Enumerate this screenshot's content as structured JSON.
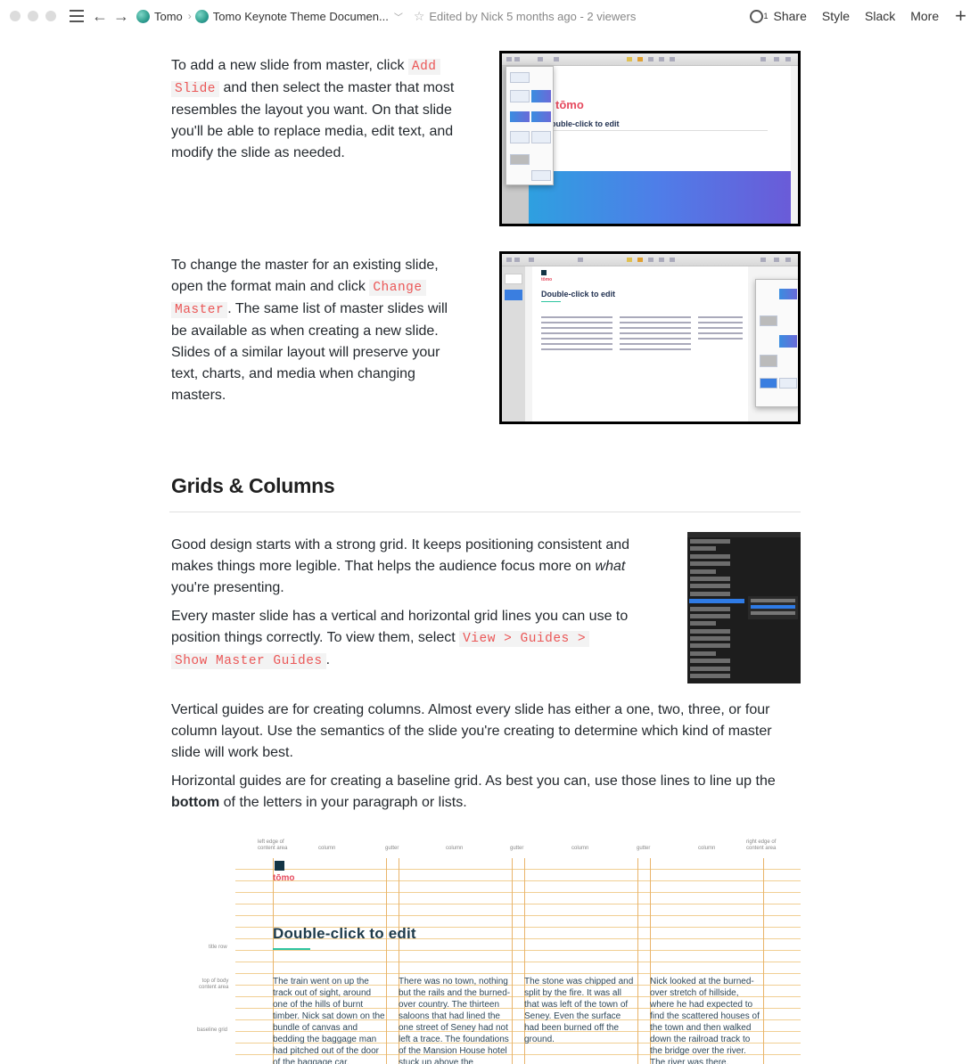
{
  "topbar": {
    "breadcrumb_root": "Tomo",
    "breadcrumb_page": "Tomo Keynote Theme Documen...",
    "edited": "Edited by Nick 5 months ago - 2 viewers",
    "viewers_count": "1",
    "share": "Share",
    "style": "Style",
    "slack": "Slack",
    "more": "More"
  },
  "section_add": {
    "text_before": "To add a new slide from master, click ",
    "code1": "Add",
    "code2": "Slide",
    "text_after": " and then select the master that most resembles the layout you want. On that slide you'll be able to replace media, edit text, and modify the slide as needed.",
    "shot_title": "ouble-click to edit"
  },
  "section_change": {
    "text_before": "To change the master for an existing slide, open the format main and click ",
    "code1": "Change",
    "code2": "Master",
    "text_after": ". The same list of master slides will be available as when creating a new slide. Slides of a similar layout will preserve your text, charts, and media when changing masters.",
    "shot_title": "Double-click to edit"
  },
  "grids": {
    "heading": "Grids & Columns",
    "p1_before": "Good design starts with a strong grid. It keeps positioning consistent and makes things more legible. That helps the audience focus more on ",
    "p1_em": "what",
    "p1_after": " you're presenting.",
    "p2_before": "Every master slide has a vertical and horizontal grid lines you can use to position things correctly. To view them, select ",
    "p2_code1": "View > Guides >",
    "p2_code2": "Show Master Guides",
    "p2_after": ".",
    "p3": "Vertical guides are for creating columns. Almost every slide has either a one, two, three, or four column layout. Use the semantics of the slide you're creating to determine which kind of master slide will work best.",
    "p4_before": "Horizontal guides are for creating a baseline grid. As best you can, use those lines to line up the ",
    "p4_bold": "bottom",
    "p4_after": " of the letters in your paragraph or lists."
  },
  "diagram": {
    "top_labels": {
      "left_edge_1": "left edge of",
      "left_edge_2": "content area",
      "column": "column",
      "gutter": "gutter",
      "right_edge_1": "right edge of",
      "right_edge_2": "content area"
    },
    "side_labels": {
      "title_row": "title row",
      "top_body_1": "top of body",
      "top_body_2": "content area",
      "baseline_grid": "baseline grid"
    },
    "logo": "tōmo",
    "title": "Double-click to edit",
    "columns": [
      "The train went on up the track out of sight, around one of the hills of burnt timber. Nick sat down on the bundle of canvas and bedding the baggage man had pitched out of the door of the baggage car.",
      "There was no town, nothing but the rails and the burned-over country. The thirteen saloons that had lined the one street of Seney had not left a trace. The foundations of the Mansion House hotel stuck up above the",
      "The stone was chipped and split by the fire. It was all that was left of the town of Seney. Even the surface had been burned off the ground.",
      "Nick looked at the burned-over stretch of hillside, where he had expected to find the scattered houses of the town and then walked down the railroad track to the bridge over the river. The river was there."
    ]
  }
}
